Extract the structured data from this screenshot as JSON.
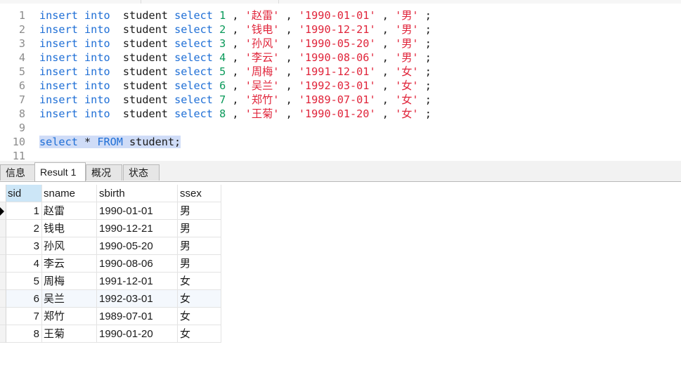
{
  "editor": {
    "lines": [
      {
        "no": "1",
        "values": [
          "1",
          "'赵雷'",
          "'1990-01-01'",
          "'男'"
        ]
      },
      {
        "no": "2",
        "values": [
          "2",
          "'钱电'",
          "'1990-12-21'",
          "'男'"
        ]
      },
      {
        "no": "3",
        "values": [
          "3",
          "'孙风'",
          "'1990-05-20'",
          "'男'"
        ]
      },
      {
        "no": "4",
        "values": [
          "4",
          "'李云'",
          "'1990-08-06'",
          "'男'"
        ]
      },
      {
        "no": "5",
        "values": [
          "5",
          "'周梅'",
          "'1991-12-01'",
          "'女'"
        ]
      },
      {
        "no": "6",
        "values": [
          "6",
          "'吴兰'",
          "'1992-03-01'",
          "'女'"
        ]
      },
      {
        "no": "7",
        "values": [
          "7",
          "'郑竹'",
          "'1989-07-01'",
          "'女'"
        ]
      },
      {
        "no": "8",
        "values": [
          "8",
          "'王菊'",
          "'1990-01-20'",
          "'女'"
        ]
      }
    ],
    "insert_tokens": {
      "kw1": "insert",
      "kw2": "into",
      "table": "student",
      "kw3": "select",
      "sep": ",",
      "end": ";"
    },
    "blank_line_no": "9",
    "query_line_no": "10",
    "query_text": "select * FROM student;",
    "last_line_no": "11"
  },
  "tabs": [
    {
      "label": "信息",
      "active": false
    },
    {
      "label": "Result 1",
      "active": true
    },
    {
      "label": "概况",
      "active": false
    },
    {
      "label": "状态",
      "active": false
    }
  ],
  "result": {
    "columns": [
      "sid",
      "sname",
      "sbirth",
      "ssex"
    ],
    "rows": [
      [
        "1",
        "赵雷",
        "1990-01-01",
        "男"
      ],
      [
        "2",
        "钱电",
        "1990-12-21",
        "男"
      ],
      [
        "3",
        "孙风",
        "1990-05-20",
        "男"
      ],
      [
        "4",
        "李云",
        "1990-08-06",
        "男"
      ],
      [
        "5",
        "周梅",
        "1991-12-01",
        "女"
      ],
      [
        "6",
        "吴兰",
        "1992-03-01",
        "女"
      ],
      [
        "7",
        "郑竹",
        "1989-07-01",
        "女"
      ],
      [
        "8",
        "王菊",
        "1990-01-20",
        "女"
      ]
    ]
  }
}
